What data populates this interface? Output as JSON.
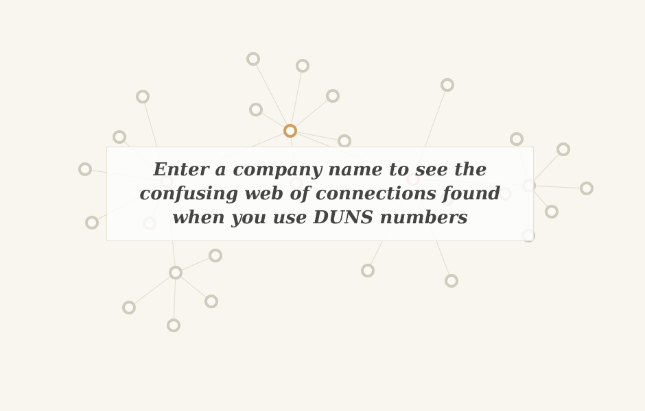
{
  "prompt": {
    "text": "Enter a company name to see the confusing web of connections found when you use DUNS numbers"
  },
  "colors": {
    "background": "#f8f6ee",
    "node_stroke": "#cfcbbd",
    "highlight_node_stroke": "#cf9e5e",
    "edge": "#dedbd0",
    "text": "#444444"
  }
}
